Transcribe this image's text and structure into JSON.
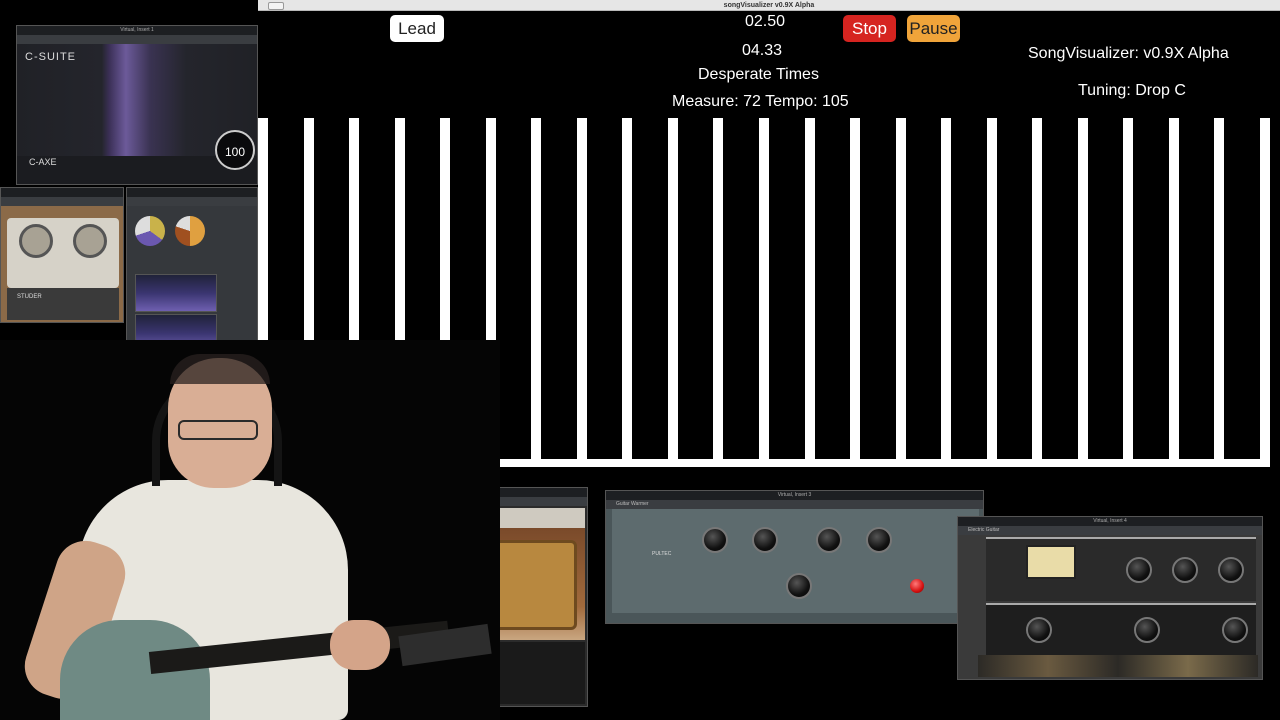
{
  "window": {
    "title": "songVisualizer v0.9X Alpha"
  },
  "controls": {
    "lead_label": "Lead",
    "stop_label": "Stop",
    "pause_label": "Pause"
  },
  "playback": {
    "elapsed": "02.50",
    "total": "04.33",
    "song_title": "Desperate Times",
    "measure_tempo": "Measure: 72 Tempo: 105"
  },
  "app": {
    "version": "SongVisualizer: v0.9X Alpha",
    "tuning": "Tuning: Drop C"
  },
  "visualizer": {
    "bar_count": 23,
    "bar_color": "#ffffff"
  },
  "plugins": {
    "csuite": {
      "window_title": "Virtual, Insert 1",
      "logo": "C-SUITE",
      "section": "C-AXE",
      "value": "100"
    },
    "studer": {
      "label": "STUDER"
    },
    "pultec": {
      "window_title": "Virtual, Insert 3",
      "preset": "Guitar Warmer",
      "brand": "PULTEC"
    },
    "guitar_amp": {
      "window_title": "Virtual, Insert 4",
      "preset": "Electric Guitar"
    }
  },
  "colors": {
    "stop": "#d62420",
    "pause": "#f0a43a",
    "lead": "#ffffff"
  }
}
